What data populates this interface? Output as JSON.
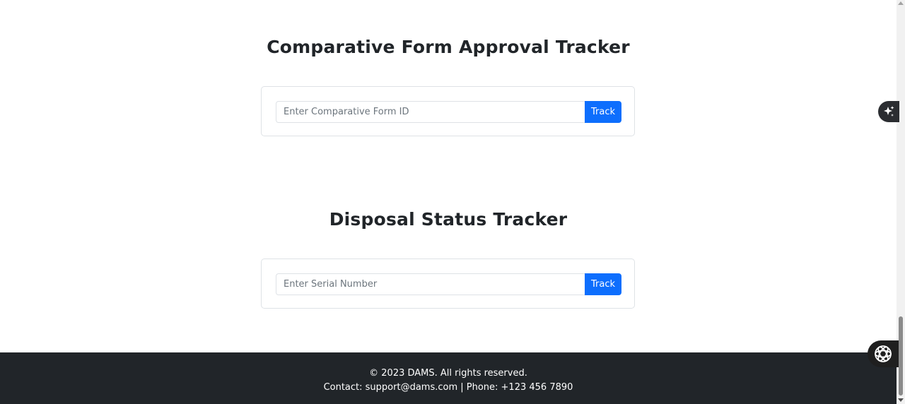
{
  "sections": [
    {
      "title": "Comparative Form Approval Tracker",
      "input_placeholder": "Enter Comparative Form ID",
      "input_value": "",
      "button_label": "Track"
    },
    {
      "title": "Disposal Status Tracker",
      "input_placeholder": "Enter Serial Number",
      "input_value": "",
      "button_label": "Track"
    }
  ],
  "footer": {
    "copyright": "© 2023 DAMS. All rights reserved.",
    "contact": "Contact: support@dams.com | Phone: +123 456 7890"
  },
  "colors": {
    "primary": "#0d6efd",
    "footer_bg": "#212529",
    "text": "#212529",
    "border": "#dee2e6"
  },
  "icons": {
    "sparkle": "sparkle-icon",
    "assistant": "assistant-icon"
  }
}
